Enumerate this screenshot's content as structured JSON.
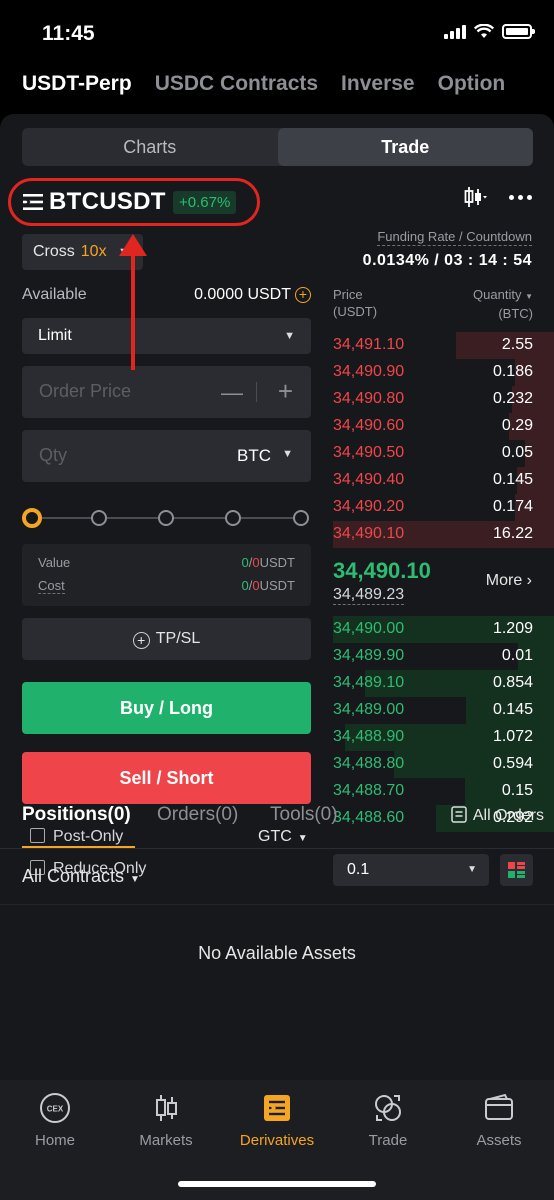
{
  "status_bar": {
    "time": "11:45"
  },
  "market_tabs": [
    "USDT-Perp",
    "USDC Contracts",
    "Inverse",
    "Option"
  ],
  "view_toggle": {
    "charts": "Charts",
    "trade": "Trade"
  },
  "symbol": {
    "name": "BTCUSDT",
    "change": "+0.67%"
  },
  "margin": {
    "mode": "Cross",
    "leverage": "10x"
  },
  "funding": {
    "label": "Funding Rate / Countdown",
    "value": "0.0134% / 03 : 14 : 54"
  },
  "form": {
    "available_label": "Available",
    "available_value": "0.0000 USDT",
    "order_type": "Limit",
    "price_placeholder": "Order Price",
    "qty_placeholder": "Qty",
    "qty_unit": "BTC",
    "slider_level_percent": 0,
    "value_label": "Value",
    "value_a": "0",
    "value_b": "0",
    "value_unit": "USDT",
    "cost_label": "Cost",
    "cost_a": "0",
    "cost_b": "0",
    "cost_unit": "USDT",
    "tpsl": "TP/SL",
    "buy": "Buy / Long",
    "sell": "Sell / Short",
    "post_only": "Post-Only",
    "reduce_only": "Reduce-Only",
    "tif": "GTC"
  },
  "orderbook": {
    "price_header": "Price",
    "price_unit": "(USDT)",
    "qty_header": "Quantity",
    "qty_unit": "(BTC)",
    "asks": [
      {
        "price": "34,491.10",
        "qty": "2.55"
      },
      {
        "price": "34,490.90",
        "qty": "0.186"
      },
      {
        "price": "34,490.80",
        "qty": "0.232"
      },
      {
        "price": "34,490.60",
        "qty": "0.29"
      },
      {
        "price": "34,490.50",
        "qty": "0.05"
      },
      {
        "price": "34,490.40",
        "qty": "0.145"
      },
      {
        "price": "34,490.20",
        "qty": "0.174"
      },
      {
        "price": "34,490.10",
        "qty": "16.22"
      }
    ],
    "last_price": "34,490.10",
    "mark_price": "34,489.23",
    "more": "More",
    "bids": [
      {
        "price": "34,490.00",
        "qty": "1.209"
      },
      {
        "price": "34,489.90",
        "qty": "0.01"
      },
      {
        "price": "34,489.10",
        "qty": "0.854"
      },
      {
        "price": "34,489.00",
        "qty": "0.145"
      },
      {
        "price": "34,488.90",
        "qty": "1.072"
      },
      {
        "price": "34,488.80",
        "qty": "0.594"
      },
      {
        "price": "34,488.70",
        "qty": "0.15"
      },
      {
        "price": "34,488.60",
        "qty": "0.292"
      }
    ],
    "depth": "0.1"
  },
  "positions": {
    "tabs": [
      "Positions(0)",
      "Orders(0)",
      "Tools(0)"
    ],
    "all_orders": "All Orders",
    "filter": "All Contracts",
    "empty": "No Available Assets"
  },
  "bottom_nav": [
    {
      "label": "Home",
      "icon": "cex-logo-icon"
    },
    {
      "label": "Markets",
      "icon": "candlestick-icon"
    },
    {
      "label": "Derivatives",
      "icon": "derivatives-icon"
    },
    {
      "label": "Trade",
      "icon": "exchange-icon"
    },
    {
      "label": "Assets",
      "icon": "wallet-icon"
    }
  ],
  "home_icon_text": "CEX",
  "colors": {
    "accent": "#f5a524",
    "buy": "#20b26c",
    "sell": "#ef454a",
    "highlight_annotation": "#e0261f"
  }
}
